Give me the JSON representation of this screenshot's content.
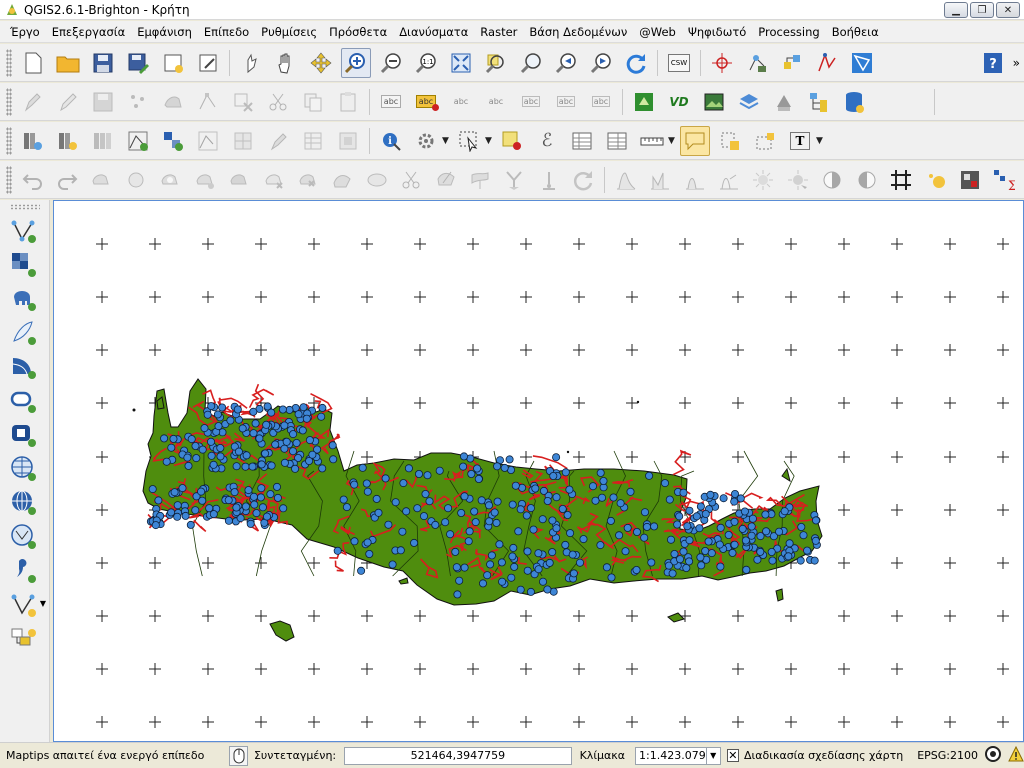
{
  "window": {
    "title": "QGIS2.6.1-Brighton - Κρήτη"
  },
  "menu": [
    "Έργο",
    "Επεξεργασία",
    "Εμφάνιση",
    "Επίπεδο",
    "Ρυθμίσεις",
    "Πρόσθετα",
    "Διανύσματα",
    "Raster",
    "Βάση Δεδομένων",
    "@Web",
    "Ψηφιδωτό",
    "Processing",
    "Βοήθεια"
  ],
  "toolbars": {
    "csw_label": "CSW",
    "abc_label": "abc",
    "vd_label": "VD",
    "text_tool_label": "T"
  },
  "status": {
    "message": "Maptips απαιτεί ένα ενεργό επίπεδο",
    "coord_label": "Συντεταγμένη:",
    "coord_value": "521464,3947759",
    "scale_label": "Κλίμακα",
    "scale_value": "1:1.423.079",
    "render_label": "Διαδικασία σχεδίασης χάρτη",
    "render_checked": true,
    "crs": "EPSG:2100"
  },
  "colors": {
    "land": "#4f8d0e",
    "roads": "#d81f1f",
    "points": "#3e86d6",
    "canvas_border": "#5a8dd6"
  }
}
